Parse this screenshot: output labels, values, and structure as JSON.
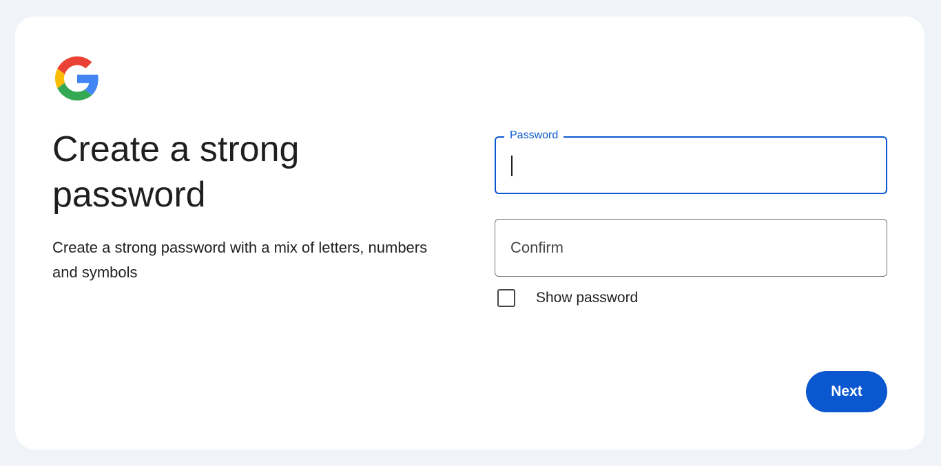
{
  "brand": {
    "logo_icon": "google-g-icon",
    "colors": {
      "blue": "#4285F4",
      "red": "#EA4335",
      "yellow": "#FBBC05",
      "green": "#34A853"
    }
  },
  "heading": {
    "title": "Create a strong password",
    "subtitle": "Create a strong password with a mix of letters, numbers and symbols"
  },
  "form": {
    "password": {
      "label": "Password",
      "value": ""
    },
    "confirm": {
      "placeholder": "Confirm",
      "value": ""
    },
    "show_password": {
      "label": "Show password",
      "checked": false
    }
  },
  "actions": {
    "next_label": "Next"
  },
  "theme": {
    "accent": "#0b57d0",
    "page_bg": "#f0f4f9",
    "card_bg": "#ffffff"
  }
}
